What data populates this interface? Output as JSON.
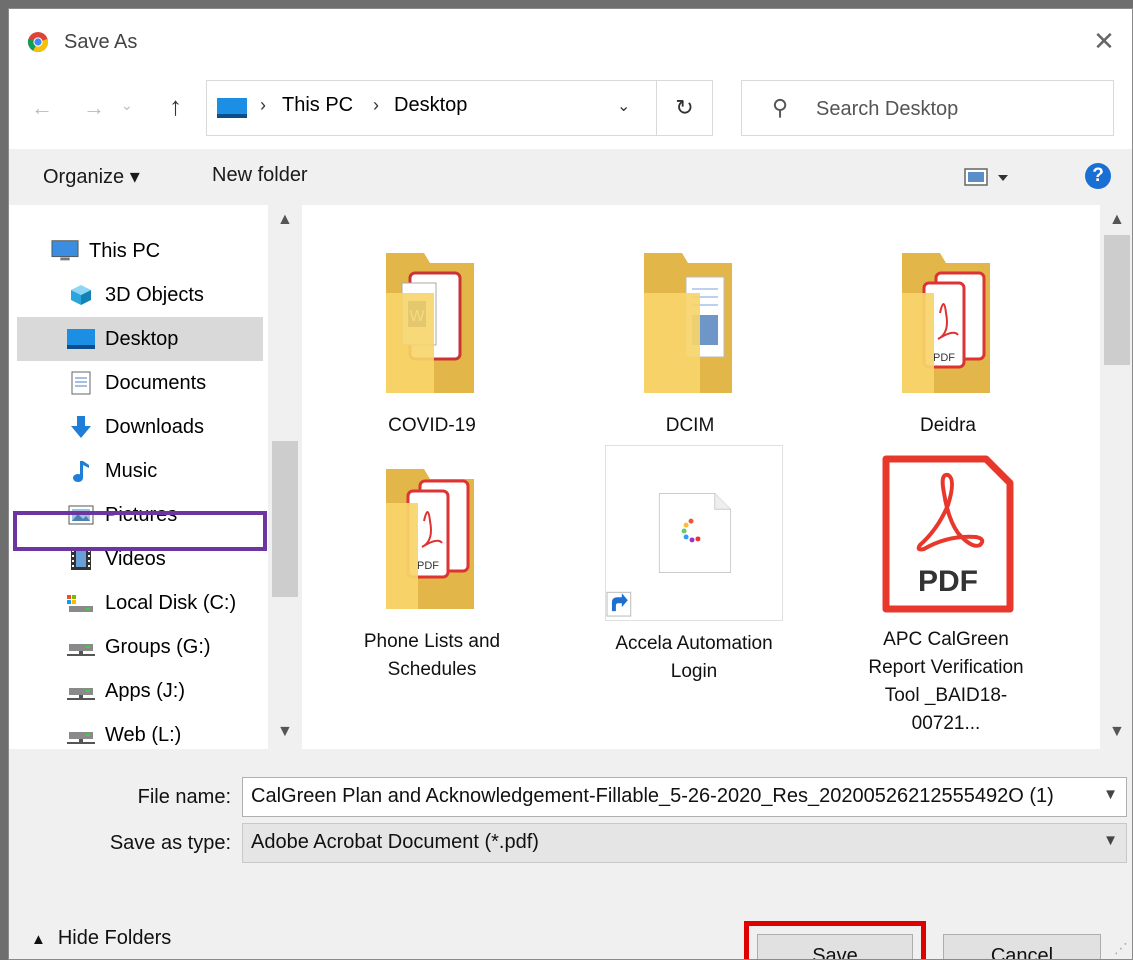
{
  "window": {
    "title": "Save As",
    "close_glyph": "✕"
  },
  "nav": {
    "back_glyph": "←",
    "forward_glyph": "→",
    "recent_glyph": "⌄",
    "up_glyph": "↑",
    "breadcrumb": [
      "This PC",
      "Desktop"
    ],
    "breadcrumb_sep": "›",
    "dropdown_glyph": "⌄",
    "refresh_glyph": "↻",
    "search_placeholder": "Search Desktop"
  },
  "toolbar": {
    "organize_label": "Organize ▾",
    "new_folder_label": "New folder",
    "help_label": "?"
  },
  "sidebar": {
    "items": [
      {
        "label": "This PC",
        "icon": "computer-icon"
      },
      {
        "label": "3D Objects",
        "icon": "cube-icon"
      },
      {
        "label": "Desktop",
        "icon": "desktop-icon",
        "selected": true
      },
      {
        "label": "Documents",
        "icon": "document-icon"
      },
      {
        "label": "Downloads",
        "icon": "download-icon"
      },
      {
        "label": "Music",
        "icon": "music-icon"
      },
      {
        "label": "Pictures",
        "icon": "pictures-icon"
      },
      {
        "label": "Videos",
        "icon": "video-icon"
      },
      {
        "label": "Local Disk (C:)",
        "icon": "drive-icon"
      },
      {
        "label": "Groups (G:)",
        "icon": "network-drive-icon"
      },
      {
        "label": "Apps (J:)",
        "icon": "network-drive-icon"
      },
      {
        "label": "Web (L:)",
        "icon": "network-drive-icon"
      }
    ]
  },
  "files": {
    "items": [
      {
        "label": "COVID-19",
        "type": "folder"
      },
      {
        "label": "DCIM",
        "type": "folder"
      },
      {
        "label": "Deidra",
        "type": "folder"
      },
      {
        "label": "Phone Lists and Schedules",
        "type": "folder"
      },
      {
        "label": "Accela Automation Login",
        "type": "shortcut"
      },
      {
        "label": "APC CalGreen Report Verification Tool _BAID18-00721...",
        "type": "pdf"
      }
    ],
    "pdf_text": "PDF"
  },
  "form": {
    "file_name_label": "File name:",
    "file_name_value": "CalGreen Plan and Acknowledgement-Fillable_5-26-2020_Res_20200526212555492O (1)",
    "save_type_label": "Save as type:",
    "save_type_value": "Adobe Acrobat Document (*.pdf)",
    "hide_folders_label": "Hide Folders",
    "save_label": "Save",
    "cancel_label": "Cancel"
  },
  "colors": {
    "highlight_purple": "#6c35a0",
    "highlight_red": "#e00000",
    "folder_yellow": "#f7d56a",
    "pdf_red": "#e8382b",
    "help_blue": "#1a6fd4"
  }
}
